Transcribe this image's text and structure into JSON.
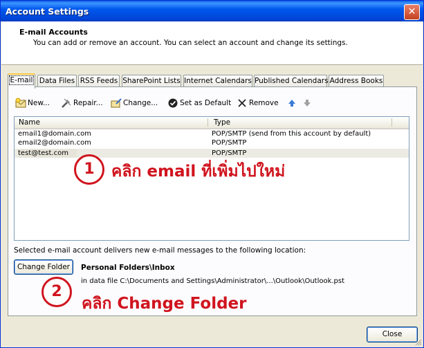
{
  "window": {
    "title": "Account Settings",
    "close_glyph": "✕"
  },
  "header": {
    "title": "E-mail Accounts",
    "description": "You can add or remove an account. You can select an account and change its settings."
  },
  "tabs": [
    {
      "label": "E-mail"
    },
    {
      "label": "Data Files"
    },
    {
      "label": "RSS Feeds"
    },
    {
      "label": "SharePoint Lists"
    },
    {
      "label": "Internet Calendars"
    },
    {
      "label": "Published Calendars"
    },
    {
      "label": "Address Books"
    }
  ],
  "toolbar": {
    "new_label": "New...",
    "repair_label": "Repair...",
    "change_label": "Change...",
    "default_label": "Set as Default",
    "remove_label": "Remove"
  },
  "list": {
    "columns": {
      "name": "Name",
      "type": "Type"
    },
    "rows": [
      {
        "name": "email1@domain.com",
        "type": "POP/SMTP (send from this account by default)"
      },
      {
        "name": "email2@domain.com",
        "type": "POP/SMTP"
      },
      {
        "name": "test@test.com",
        "type": "POP/SMTP"
      }
    ]
  },
  "delivery": {
    "text": "Selected e-mail account delivers new e-mail messages to the following location:",
    "button_label": "Change Folder",
    "folder_name": "Personal Folders\\Inbox",
    "folder_path": "in data file C:\\Documents and Settings\\Administrator\\...\\Outlook\\Outlook.pst"
  },
  "annotations": [
    {
      "number": "1",
      "text": "คลิก email ที่เพิ่มไปใหม่"
    },
    {
      "number": "2",
      "text": "คลิก Change Folder"
    }
  ],
  "footer": {
    "close_label": "Close"
  },
  "colors": {
    "accent_red": "#d0141e",
    "title_blue": "#0058ee",
    "dialog_bg": "#ece9d8"
  }
}
